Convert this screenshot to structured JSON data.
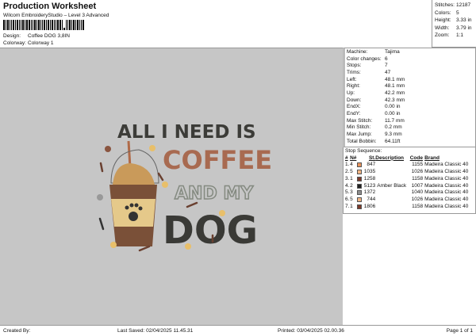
{
  "header": {
    "title": "Production Worksheet",
    "subtitle": "Wilcom EmbroideryStudio – Level 3 Advanced",
    "design_label": "Design:",
    "design_value": "Coffee DOG 3,8IN",
    "colorway_label": "Colorway:",
    "colorway_value": "Colorway 1"
  },
  "summary": [
    {
      "label": "Stitches:",
      "value": "12187"
    },
    {
      "label": "Colors:",
      "value": "5"
    },
    {
      "label": "Height:",
      "value": "3.33 in"
    },
    {
      "label": "Width:",
      "value": "3.79 in"
    },
    {
      "label": "Zoom:",
      "value": "1:1"
    }
  ],
  "machine": [
    {
      "label": "Machine:",
      "value": "Tajima"
    },
    {
      "label": "Color changes:",
      "value": "6"
    },
    {
      "label": "Stops:",
      "value": "7"
    },
    {
      "label": "Trims:",
      "value": "47"
    },
    {
      "label": "Left:",
      "value": "48.1 mm"
    },
    {
      "label": "Right:",
      "value": "48.1 mm"
    },
    {
      "label": "Up:",
      "value": "42.2 mm"
    },
    {
      "label": "Down:",
      "value": "42.3 mm"
    },
    {
      "label": "EndX:",
      "value": "0.00 in"
    },
    {
      "label": "EndY:",
      "value": "0.00 in"
    },
    {
      "label": "Max Stitch:",
      "value": "11.7 mm"
    },
    {
      "label": "Min Stitch:",
      "value": "0.2 mm"
    },
    {
      "label": "Max Jump:",
      "value": "9.3 mm"
    },
    {
      "label": "Total Bobbin:",
      "value": "64.11ft"
    }
  ],
  "stop_sequence": {
    "title": "Stop Sequence:",
    "headers": [
      "#",
      "N#",
      "St.",
      "Description",
      "Code",
      "Brand"
    ],
    "rows": [
      {
        "n": "1.",
        "needle": "4",
        "color": "#e8935c",
        "st": "847",
        "desc": "",
        "code": "1155",
        "brand": "Madeira Classic 40"
      },
      {
        "n": "2.",
        "needle": "5",
        "color": "#f2b584",
        "st": "1035",
        "desc": "",
        "code": "1026",
        "brand": "Madeira Classic 40"
      },
      {
        "n": "3.",
        "needle": "1",
        "color": "#7d3b2b",
        "st": "1258",
        "desc": "",
        "code": "1158",
        "brand": "Madeira Classic 40"
      },
      {
        "n": "4.",
        "needle": "2",
        "color": "#222222",
        "st": "5123",
        "desc": "Amber Black",
        "code": "1007",
        "brand": "Madeira Classic 40"
      },
      {
        "n": "5.",
        "needle": "3",
        "color": "#8e8e8e",
        "st": "1372",
        "desc": "",
        "code": "1040",
        "brand": "Madeira Classic 40"
      },
      {
        "n": "6.",
        "needle": "5",
        "color": "#f2b584",
        "st": "744",
        "desc": "",
        "code": "1026",
        "brand": "Madeira Classic 40"
      },
      {
        "n": "7.",
        "needle": "1",
        "color": "#7d3b2b",
        "st": "1806",
        "desc": "",
        "code": "1158",
        "brand": "Madeira Classic 40"
      }
    ]
  },
  "design_artwork": {
    "line1": "ALL I NEED IS",
    "line2": "COFFEE",
    "line3": "AND MY",
    "line4": "DOG"
  },
  "footer": {
    "created_by": "Created By:",
    "last_saved": "Last Saved: 02/04/2025 11.45.31",
    "printed": "Printed: 03/04/2025 02.00.36",
    "page": "Page 1 of 1"
  }
}
